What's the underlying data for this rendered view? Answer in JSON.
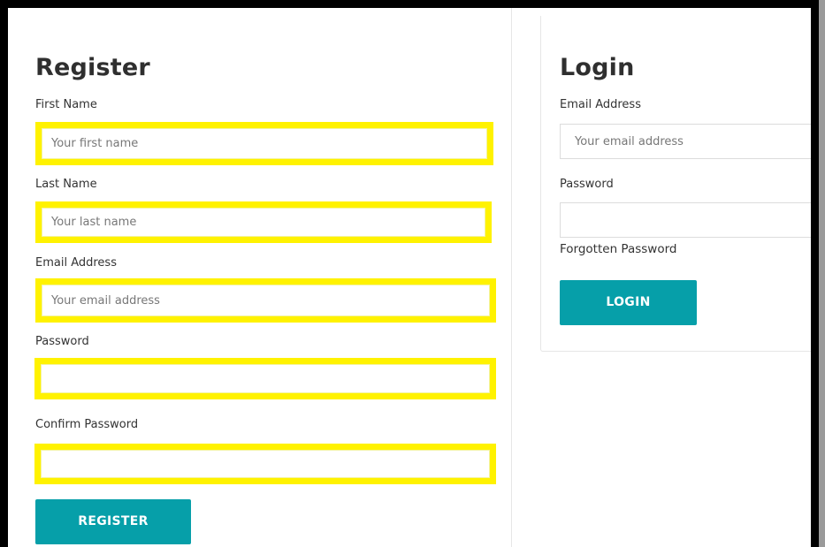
{
  "register": {
    "title": "Register",
    "first_name": {
      "label": "First Name",
      "placeholder": "Your first name"
    },
    "last_name": {
      "label": "Last Name",
      "placeholder": "Your last name"
    },
    "email": {
      "label": "Email Address",
      "placeholder": "Your email address"
    },
    "password": {
      "label": "Password",
      "placeholder": ""
    },
    "confirm_password": {
      "label": "Confirm Password",
      "placeholder": ""
    },
    "submit_label": "REGISTER"
  },
  "login": {
    "title": "Login",
    "email": {
      "label": "Email Address",
      "placeholder": "Your email address"
    },
    "password": {
      "label": "Password",
      "placeholder": ""
    },
    "forgot_label": "Forgotten Password",
    "submit_label": "LOGIN"
  },
  "colors": {
    "accent": "#069fa9",
    "highlight": "#fff200",
    "frame": "#000000"
  }
}
